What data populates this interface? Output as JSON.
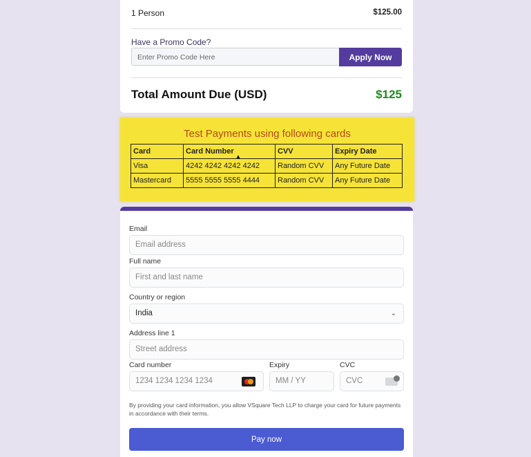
{
  "summary": {
    "person_label": "1 Person",
    "person_price": "$125.00",
    "promo_label": "Have a Promo Code?",
    "promo_placeholder": "Enter Promo Code Here",
    "apply_label": "Apply Now",
    "total_label": "Total Amount Due (USD)",
    "total_value": "$125"
  },
  "test_cards": {
    "title": "Test Payments using following cards",
    "headers": [
      "Card",
      "Card Number",
      "CVV",
      "Expiry Date"
    ],
    "rows": [
      [
        "Visa",
        "4242 4242 4242 4242",
        "Random CVV",
        "Any Future Date"
      ],
      [
        "Mastercard",
        "5555 5555 5555 4444",
        "Random CVV",
        "Any Future Date"
      ]
    ]
  },
  "payment_form": {
    "email_label": "Email",
    "email_placeholder": "Email address",
    "name_label": "Full name",
    "name_placeholder": "First and last name",
    "country_label": "Country or region",
    "country_value": "India",
    "address_label": "Address line 1",
    "address_placeholder": "Street address",
    "card_label": "Card number",
    "card_placeholder": "1234 1234 1234 1234",
    "expiry_label": "Expiry",
    "expiry_placeholder": "MM / YY",
    "cvc_label": "CVC",
    "cvc_placeholder": "CVC",
    "disclaimer": "By providing your card information, you allow VSquare Tech LLP to charge your card for future payments in accordance with their terms.",
    "pay_label": "Pay now"
  },
  "colors": {
    "accent": "#533c9e",
    "pay_button": "#4b5bd1",
    "total_green": "#1f8a22",
    "banner_yellow": "#f6e337"
  }
}
